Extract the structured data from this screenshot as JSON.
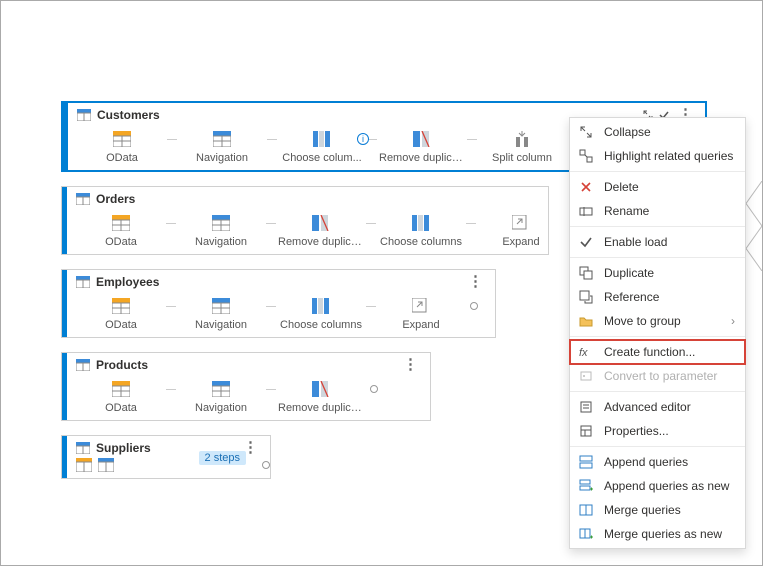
{
  "queries": {
    "customers": {
      "title": "Customers",
      "steps": [
        "OData",
        "Navigation",
        "Choose colum...",
        "Remove duplicat...",
        "Split column"
      ]
    },
    "orders": {
      "title": "Orders",
      "steps": [
        "OData",
        "Navigation",
        "Remove duplicat...",
        "Choose columns",
        "Expand"
      ]
    },
    "employees": {
      "title": "Employees",
      "steps": [
        "OData",
        "Navigation",
        "Choose columns",
        "Expand"
      ]
    },
    "products": {
      "title": "Products",
      "steps": [
        "OData",
        "Navigation",
        "Remove duplicat..."
      ]
    },
    "suppliers": {
      "title": "Suppliers",
      "steps_badge": "2 steps"
    }
  },
  "menu": {
    "collapse": "Collapse",
    "highlight_related": "Highlight related queries",
    "delete": "Delete",
    "rename": "Rename",
    "enable_load": "Enable load",
    "duplicate": "Duplicate",
    "reference": "Reference",
    "move_to_group": "Move to group",
    "create_function": "Create function...",
    "convert_to_parameter": "Convert to parameter",
    "advanced_editor": "Advanced editor",
    "properties": "Properties...",
    "append_queries": "Append queries",
    "append_queries_new": "Append queries as new",
    "merge_queries": "Merge queries",
    "merge_queries_new": "Merge queries as new"
  }
}
